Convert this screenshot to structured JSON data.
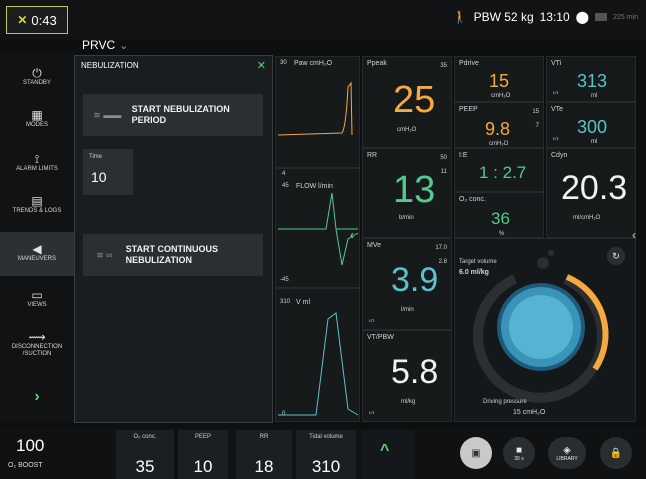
{
  "timer": {
    "value": "0:43"
  },
  "top": {
    "pbw": "PBW 52 kg",
    "time": "13:10",
    "battery": "225 min"
  },
  "mode": {
    "label": "PRVC"
  },
  "sidebar": {
    "items": [
      {
        "label": "STANDBY",
        "icon": "power-icon"
      },
      {
        "label": "MODES",
        "icon": "grid-icon"
      },
      {
        "label": "ALARM LIMITS",
        "icon": "bell-icon"
      },
      {
        "label": "TRENDS & LOGS",
        "icon": "trends-icon"
      },
      {
        "label": "MANEUVERS",
        "icon": "maneuvers-icon"
      },
      {
        "label": "VIEWS",
        "icon": "views-icon"
      },
      {
        "label": "DISCONNECTION /SUCTION",
        "icon": "disconnect-icon"
      }
    ]
  },
  "nebulization": {
    "title": "NEBULIZATION",
    "start_period": "START NEBULIZATION PERIOD",
    "time_label": "Time",
    "time_value": "10",
    "start_continuous": "START CONTINUOUS NEBULIZATION"
  },
  "waveforms": {
    "paw": "Paw cmH₂O",
    "flow": "FLOW l/min",
    "vol": "V ml",
    "paw_max": "30",
    "flow_max": "45",
    "flow_min": "-45",
    "vol_max": "310",
    "flow_zero": "4",
    "vol_zero": "0"
  },
  "params": {
    "ppeak": {
      "label": "Ppeak",
      "value": "25",
      "unit": "cmH₂O",
      "limit": "35"
    },
    "pdrive": {
      "label": "Pdrive",
      "value": "15",
      "unit": "cmH₂O"
    },
    "vti": {
      "label": "VTi",
      "value": "313",
      "unit": "ml"
    },
    "peep": {
      "label": "PEEP",
      "value": "9.8",
      "unit": "cmH₂O",
      "hi": "15",
      "lo": "7"
    },
    "vte": {
      "label": "VTe",
      "value": "300",
      "unit": "ml"
    },
    "rr": {
      "label": "RR",
      "value": "13",
      "unit": "b/min",
      "hi": "50",
      "lo": "11"
    },
    "ie": {
      "label": "I:E",
      "value": "1 : 2.7"
    },
    "cdyn": {
      "label": "Cdyn",
      "value": "20.3",
      "unit": "ml/cmH₂O"
    },
    "o2": {
      "label": "O₂ conc.",
      "value": "36",
      "unit": "%"
    },
    "mve": {
      "label": "MVe",
      "value": "3.9",
      "unit": "l/min",
      "hi": "17.0",
      "lo": "2.8"
    },
    "vtpbw": {
      "label": "VT/PBW",
      "value": "5.8",
      "unit": "ml/kg"
    },
    "target": {
      "label": "Target volume",
      "value": "6.0 ml/kg"
    },
    "driving": {
      "label": "Driving pressure",
      "value": "15 cmH₂O"
    }
  },
  "bottom": {
    "boost_value": "100",
    "boost_label": "O₂ BOOST",
    "o2_label": "O₂ conc.",
    "o2_value": "35",
    "peep_label": "PEEP",
    "peep_value": "10",
    "rr_label": "RR",
    "rr_value": "18",
    "tv_label": "Tidal volume",
    "tv_value": "310",
    "library": "LIBRARY",
    "video_sub": "30 s"
  },
  "colors": {
    "accent_green": "#53c98f",
    "accent_orange": "#f5a93e",
    "accent_teal": "#5bc1cf",
    "timer_border": "#c5c34a"
  }
}
